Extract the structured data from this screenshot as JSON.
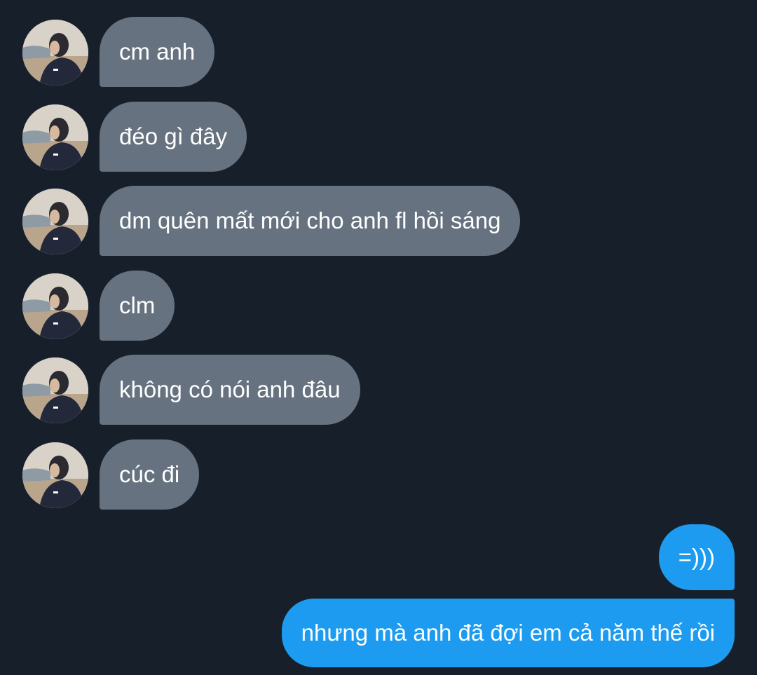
{
  "conversation": {
    "incoming": [
      {
        "text": "cm anh"
      },
      {
        "text": "đéo gì đây"
      },
      {
        "text": "dm quên mất mới cho anh fl hồi sáng"
      },
      {
        "text": "clm"
      },
      {
        "text": "không có nói anh đâu"
      },
      {
        "text": "cúc đi"
      }
    ],
    "outgoing": [
      {
        "text": "=)))"
      },
      {
        "text": "nhưng mà anh đã đợi em cả năm thế rồi"
      }
    ]
  },
  "colors": {
    "background": "#17202a",
    "incoming_bubble": "#66727f",
    "outgoing_bubble": "#1d9bf0",
    "text": "#ffffff"
  },
  "icons": {
    "avatar": "profile-photo"
  }
}
